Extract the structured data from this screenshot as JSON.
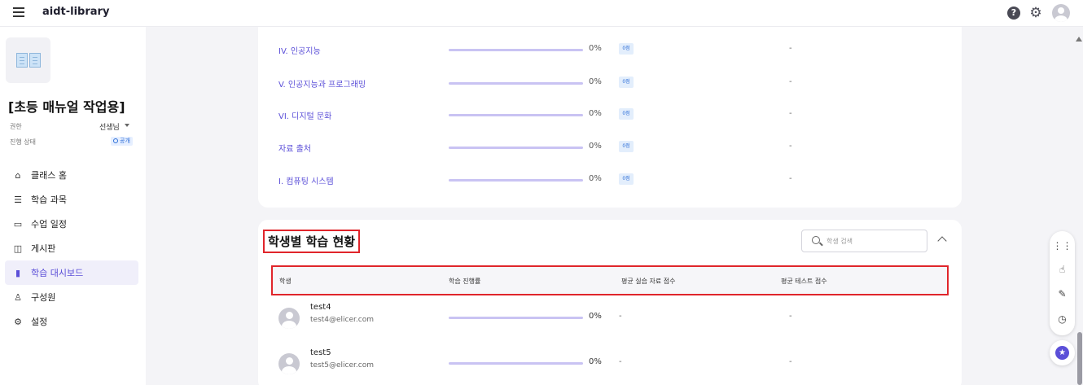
{
  "app": {
    "title": "aidt-library"
  },
  "sidebar": {
    "class_title": "[초등 매뉴얼 작업용]",
    "permission_label": "권한",
    "role_value": "선생님",
    "progress_label": "진행 상태",
    "status_value": "공개",
    "items": [
      {
        "label": "클래스 홈",
        "icon": "home-icon"
      },
      {
        "label": "학습 과목",
        "icon": "list-icon"
      },
      {
        "label": "수업 일정",
        "icon": "calendar-icon"
      },
      {
        "label": "게시판",
        "icon": "board-icon"
      },
      {
        "label": "학습 대시보드",
        "icon": "bar-chart-icon",
        "active": true
      },
      {
        "label": "구성원",
        "icon": "person-icon"
      },
      {
        "label": "설정",
        "icon": "gear-icon"
      }
    ]
  },
  "units": [
    {
      "name": "IV. 인공지능",
      "progress": "0%",
      "score": "0점",
      "extra": "-"
    },
    {
      "name": "V. 인공지능과 프로그래밍",
      "progress": "0%",
      "score": "0점",
      "extra": "-"
    },
    {
      "name": "VI. 디지털 문화",
      "progress": "0%",
      "score": "0점",
      "extra": "-"
    },
    {
      "name": "자료 출처",
      "progress": "0%",
      "score": "0점",
      "extra": "-"
    },
    {
      "name": "I. 컴퓨팅 시스템",
      "progress": "0%",
      "score": "0점",
      "extra": "-"
    }
  ],
  "student_section": {
    "title": "학생별 학습 현황",
    "search_placeholder": "학생 검색",
    "columns": [
      "학생",
      "학습 진행률",
      "평균 실습 자료 점수",
      "평균 테스트 점수"
    ],
    "students": [
      {
        "name": "test4",
        "email": "test4@elicer.com",
        "progress": "0%",
        "practice_score": "-",
        "test_score": "-"
      },
      {
        "name": "test5",
        "email": "test5@elicer.com",
        "progress": "0%",
        "practice_score": "-",
        "test_score": "-"
      }
    ]
  },
  "colors": {
    "accent": "#5b4fd8",
    "highlight_border": "#e0252b",
    "progress_track": "#c9c3f3"
  }
}
